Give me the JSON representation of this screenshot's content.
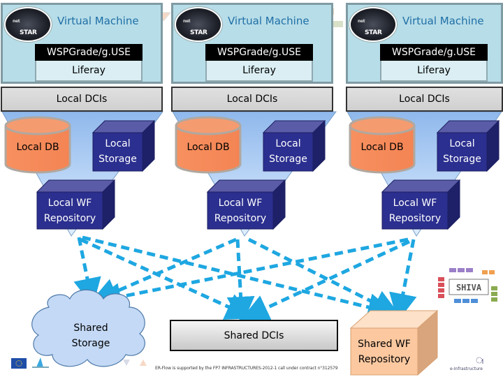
{
  "virtual_machines": [
    {
      "title": "Virtual Machine",
      "logo_text": "STAR",
      "logo_sup": "net",
      "portal": "WSPGrade/g.USE",
      "framework": "Liferay",
      "dci": "Local DCIs",
      "db": "Local DB",
      "storage": [
        "Local",
        "Storage"
      ],
      "wf_repo": [
        "Local WF",
        "Repository"
      ]
    },
    {
      "title": "Virtual Machine",
      "logo_text": "STAR",
      "logo_sup": "net",
      "portal": "WSPGrade/g.USE",
      "framework": "Liferay",
      "dci": "Local DCIs",
      "db": "Local DB",
      "storage": [
        "Local",
        "Storage"
      ],
      "wf_repo": [
        "Local WF",
        "Repository"
      ]
    },
    {
      "title": "Virtual Machine",
      "logo_text": "STAR",
      "logo_sup": "net",
      "portal": "WSPGrade/g.USE",
      "framework": "Liferay",
      "dci": "Local DCIs",
      "db": "Local DB",
      "storage": [
        "Local",
        "Storage"
      ],
      "wf_repo": [
        "Local WF",
        "Repository"
      ]
    }
  ],
  "shared": {
    "storage": [
      "Shared",
      "Storage"
    ],
    "dcis": "Shared DCIs",
    "wf_repo": [
      "Shared WF",
      "Repository"
    ]
  },
  "shiva_logo_text": "SHIVA",
  "footer": {
    "support_text": "ER-Flow is supported by the FP7 INFRASTRUCTURES-2012-1 call under contract n°312579",
    "einfra_text": "e-Infrastructure"
  },
  "colors": {
    "vm_bg": "#b7dde8",
    "vm_title": "#1f6fa6",
    "cube_blue": "#2b2f8f",
    "db_orange": "#f4895a",
    "arrow_blue": "#1ea7e1",
    "funnel_blue": "#a9cbf2",
    "shared_wf_orange": "#fbc8a0"
  }
}
